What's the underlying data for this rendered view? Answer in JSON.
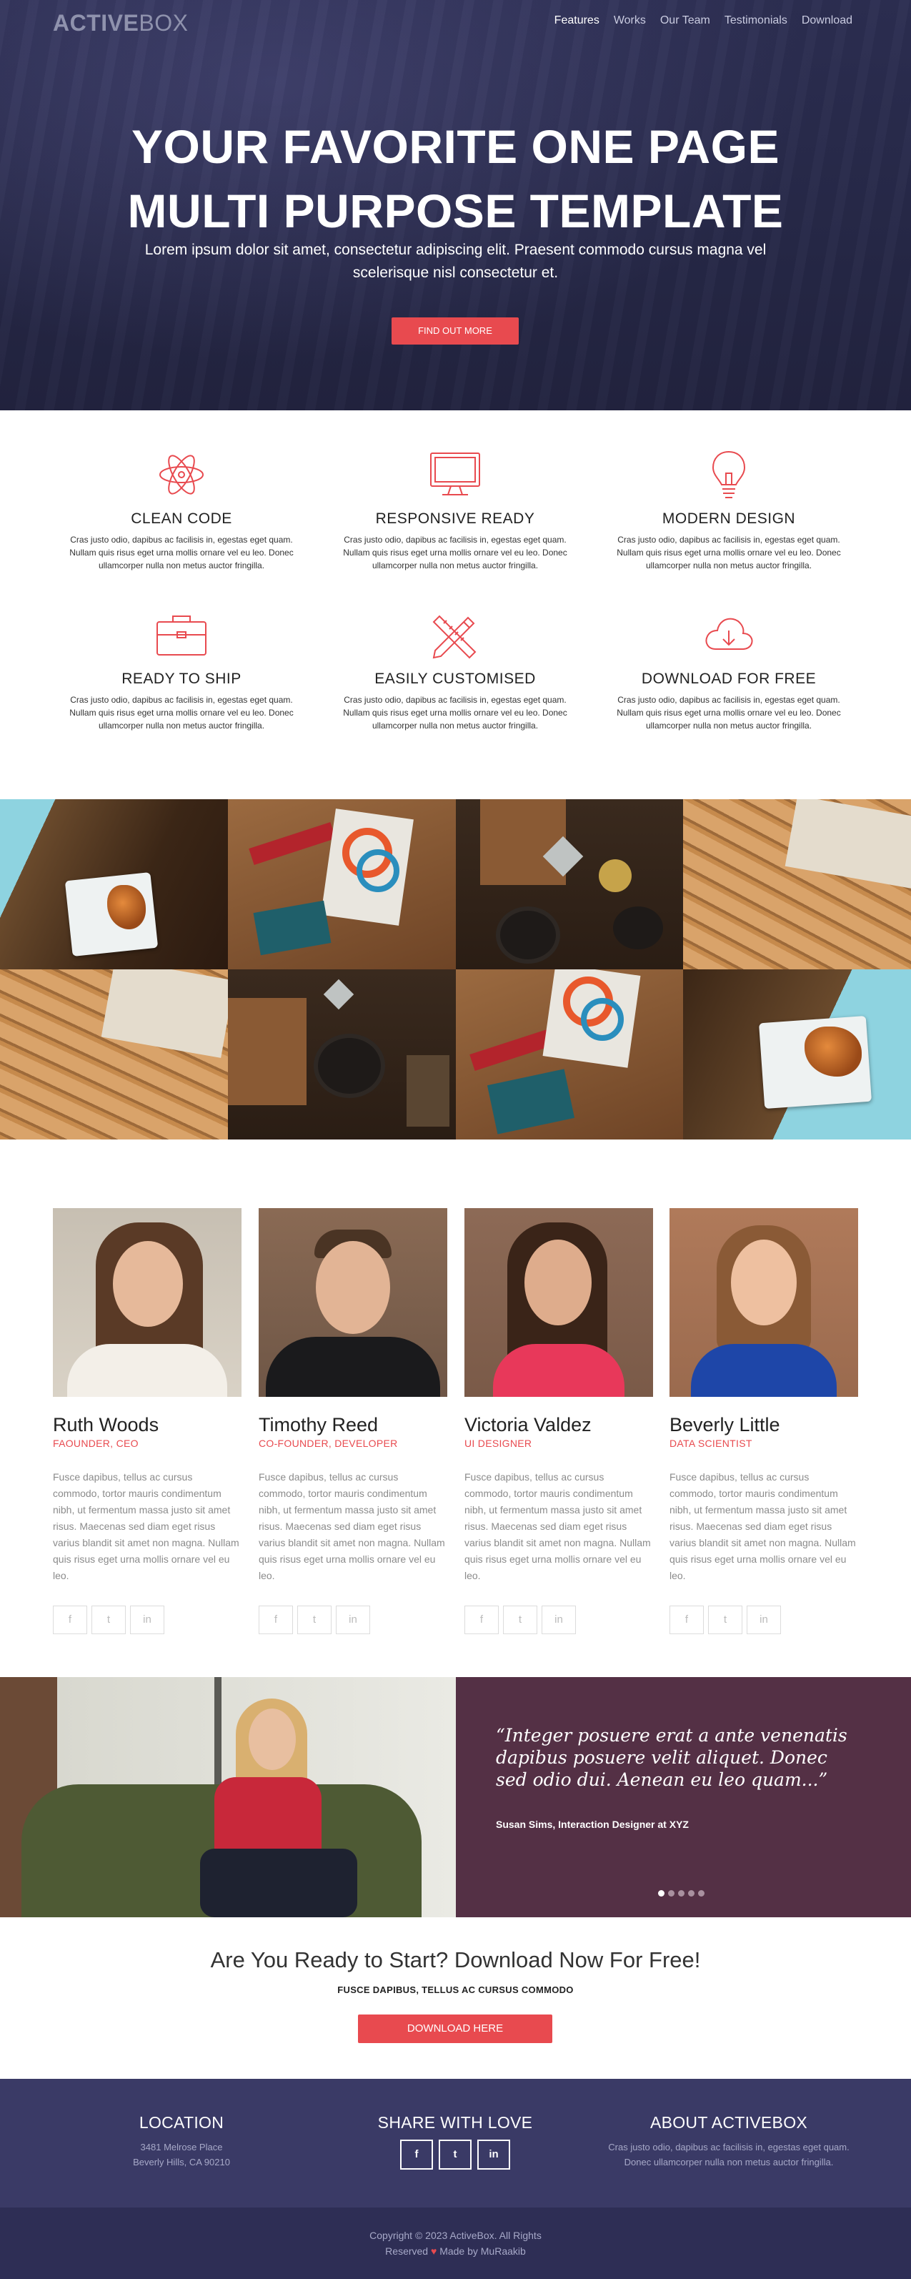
{
  "nav": {
    "logo_bold": "ACTIVE",
    "logo_light": "BOX",
    "items": [
      {
        "label": "Features",
        "active": true
      },
      {
        "label": "Works",
        "active": false
      },
      {
        "label": "Our Team",
        "active": false
      },
      {
        "label": "Testimonials",
        "active": false
      },
      {
        "label": "Download",
        "active": false
      }
    ]
  },
  "hero": {
    "title_line1": "YOUR FAVORITE ONE PAGE",
    "title_line2": "MULTI PURPOSE TEMPLATE",
    "subtitle": "Lorem ipsum dolor sit amet, consectetur adipiscing elit. Praesent commodo cursus magna vel scelerisque nisl consectetur et.",
    "button_label": "FIND OUT MORE"
  },
  "features": [
    {
      "icon": "atom-icon",
      "title": "CLEAN CODE",
      "text": "Cras justo odio, dapibus ac facilisis in, egestas eget quam. Nullam quis risus eget urna mollis ornare vel eu leo. Donec ullamcorper nulla non metus auctor fringilla."
    },
    {
      "icon": "monitor-icon",
      "title": "RESPONSIVE READY",
      "text": "Cras justo odio, dapibus ac facilisis in, egestas eget quam. Nullam quis risus eget urna mollis ornare vel eu leo. Donec ullamcorper nulla non metus auctor fringilla."
    },
    {
      "icon": "lightbulb-icon",
      "title": "MODERN DESIGN",
      "text": "Cras justo odio, dapibus ac facilisis in, egestas eget quam. Nullam quis risus eget urna mollis ornare vel eu leo. Donec ullamcorper nulla non metus auctor fringilla."
    },
    {
      "icon": "briefcase-icon",
      "title": "READY TO SHIP",
      "text": "Cras justo odio, dapibus ac facilisis in, egestas eget quam. Nullam quis risus eget urna mollis ornare vel eu leo. Donec ullamcorper nulla non metus auctor fringilla."
    },
    {
      "icon": "pencil-ruler-icon",
      "title": "EASILY CUSTOMISED",
      "text": "Cras justo odio, dapibus ac facilisis in, egestas eget quam. Nullam quis risus eget urna mollis ornare vel eu leo. Donec ullamcorper nulla non metus auctor fringilla."
    },
    {
      "icon": "cloud-download-icon",
      "title": "DOWNLOAD FOR FREE",
      "text": "Cras justo odio, dapibus ac facilisis in, egestas eget quam. Nullam quis risus eget urna mollis ornare vel eu leo. Donec ullamcorper nulla non metus auctor fringilla."
    }
  ],
  "gallery": {
    "tiles": [
      "food-plate",
      "print-design",
      "cutting-board",
      "pencils-mockup",
      "pencils-mockup",
      "cutting-board",
      "print-design",
      "food-plate"
    ]
  },
  "team": [
    {
      "name": "Ruth Woods",
      "role": "FAOUNDER, CEO",
      "bio": "Fusce dapibus, tellus ac cursus commodo, tortor mauris condimentum nibh, ut fermentum massa justo sit amet risus. Maecenas sed diam eget risus varius blandit sit amet non magna. Nullam quis risus eget urna mollis ornare vel eu leo."
    },
    {
      "name": "Timothy Reed",
      "role": "CO-FOUNDER, DEVELOPER",
      "bio": "Fusce dapibus, tellus ac cursus commodo, tortor mauris condimentum nibh, ut fermentum massa justo sit amet risus. Maecenas sed diam eget risus varius blandit sit amet non magna. Nullam quis risus eget urna mollis ornare vel eu leo."
    },
    {
      "name": "Victoria Valdez",
      "role": "UI DESIGNER",
      "bio": "Fusce dapibus, tellus ac cursus commodo, tortor mauris condimentum nibh, ut fermentum massa justo sit amet risus. Maecenas sed diam eget risus varius blandit sit amet non magna. Nullam quis risus eget urna mollis ornare vel eu leo."
    },
    {
      "name": "Beverly Little",
      "role": "DATA SCIENTIST",
      "bio": "Fusce dapibus, tellus ac cursus commodo, tortor mauris condimentum nibh, ut fermentum massa justo sit amet risus. Maecenas sed diam eget risus varius blandit sit amet non magna. Nullam quis risus eget urna mollis ornare vel eu leo."
    }
  ],
  "social_glyphs": {
    "facebook": "f",
    "twitter": "t",
    "linkedin": "in"
  },
  "testimonial": {
    "quote": "“Integer posuere erat a ante venenatis dapibus posuere velit aliquet. Donec sed odio dui. Aenean eu leo quam...”",
    "author": "Susan Sims, Interaction Designer at XYZ",
    "slides": 5,
    "active_slide": 1
  },
  "cta": {
    "title": "Are You Ready to Start? Download Now For Free!",
    "subtitle": "FUSCE DAPIBUS, TELLUS AC CURSUS COMMODO",
    "button_label": "DOWNLOAD HERE"
  },
  "footer": {
    "location_title": "LOCATION",
    "address_line1": "3481 Melrose Place",
    "address_line2": "Beverly Hills, CA 90210",
    "share_title": "SHARE WITH LOVE",
    "about_title": "ABOUT ACTIVEBOX",
    "about_line1": "Cras justo odio, dapibus ac facilisis in, egestas eget quam.",
    "about_line2": "Donec ullamcorper nulla non metus auctor fringilla.",
    "copyright_line1": "Copyright © 2023 ActiveBox. All Rights",
    "copyright_reserved": "Reserved",
    "copyright_heart": "♥",
    "copyright_made": "Made by MuRaakib"
  },
  "colors": {
    "accent": "#e84a4f",
    "hero_bg": "#272947",
    "testimonial_bg": "#543045",
    "footer_bg": "#3a3a66",
    "copyright_bg": "#2e2e55"
  }
}
